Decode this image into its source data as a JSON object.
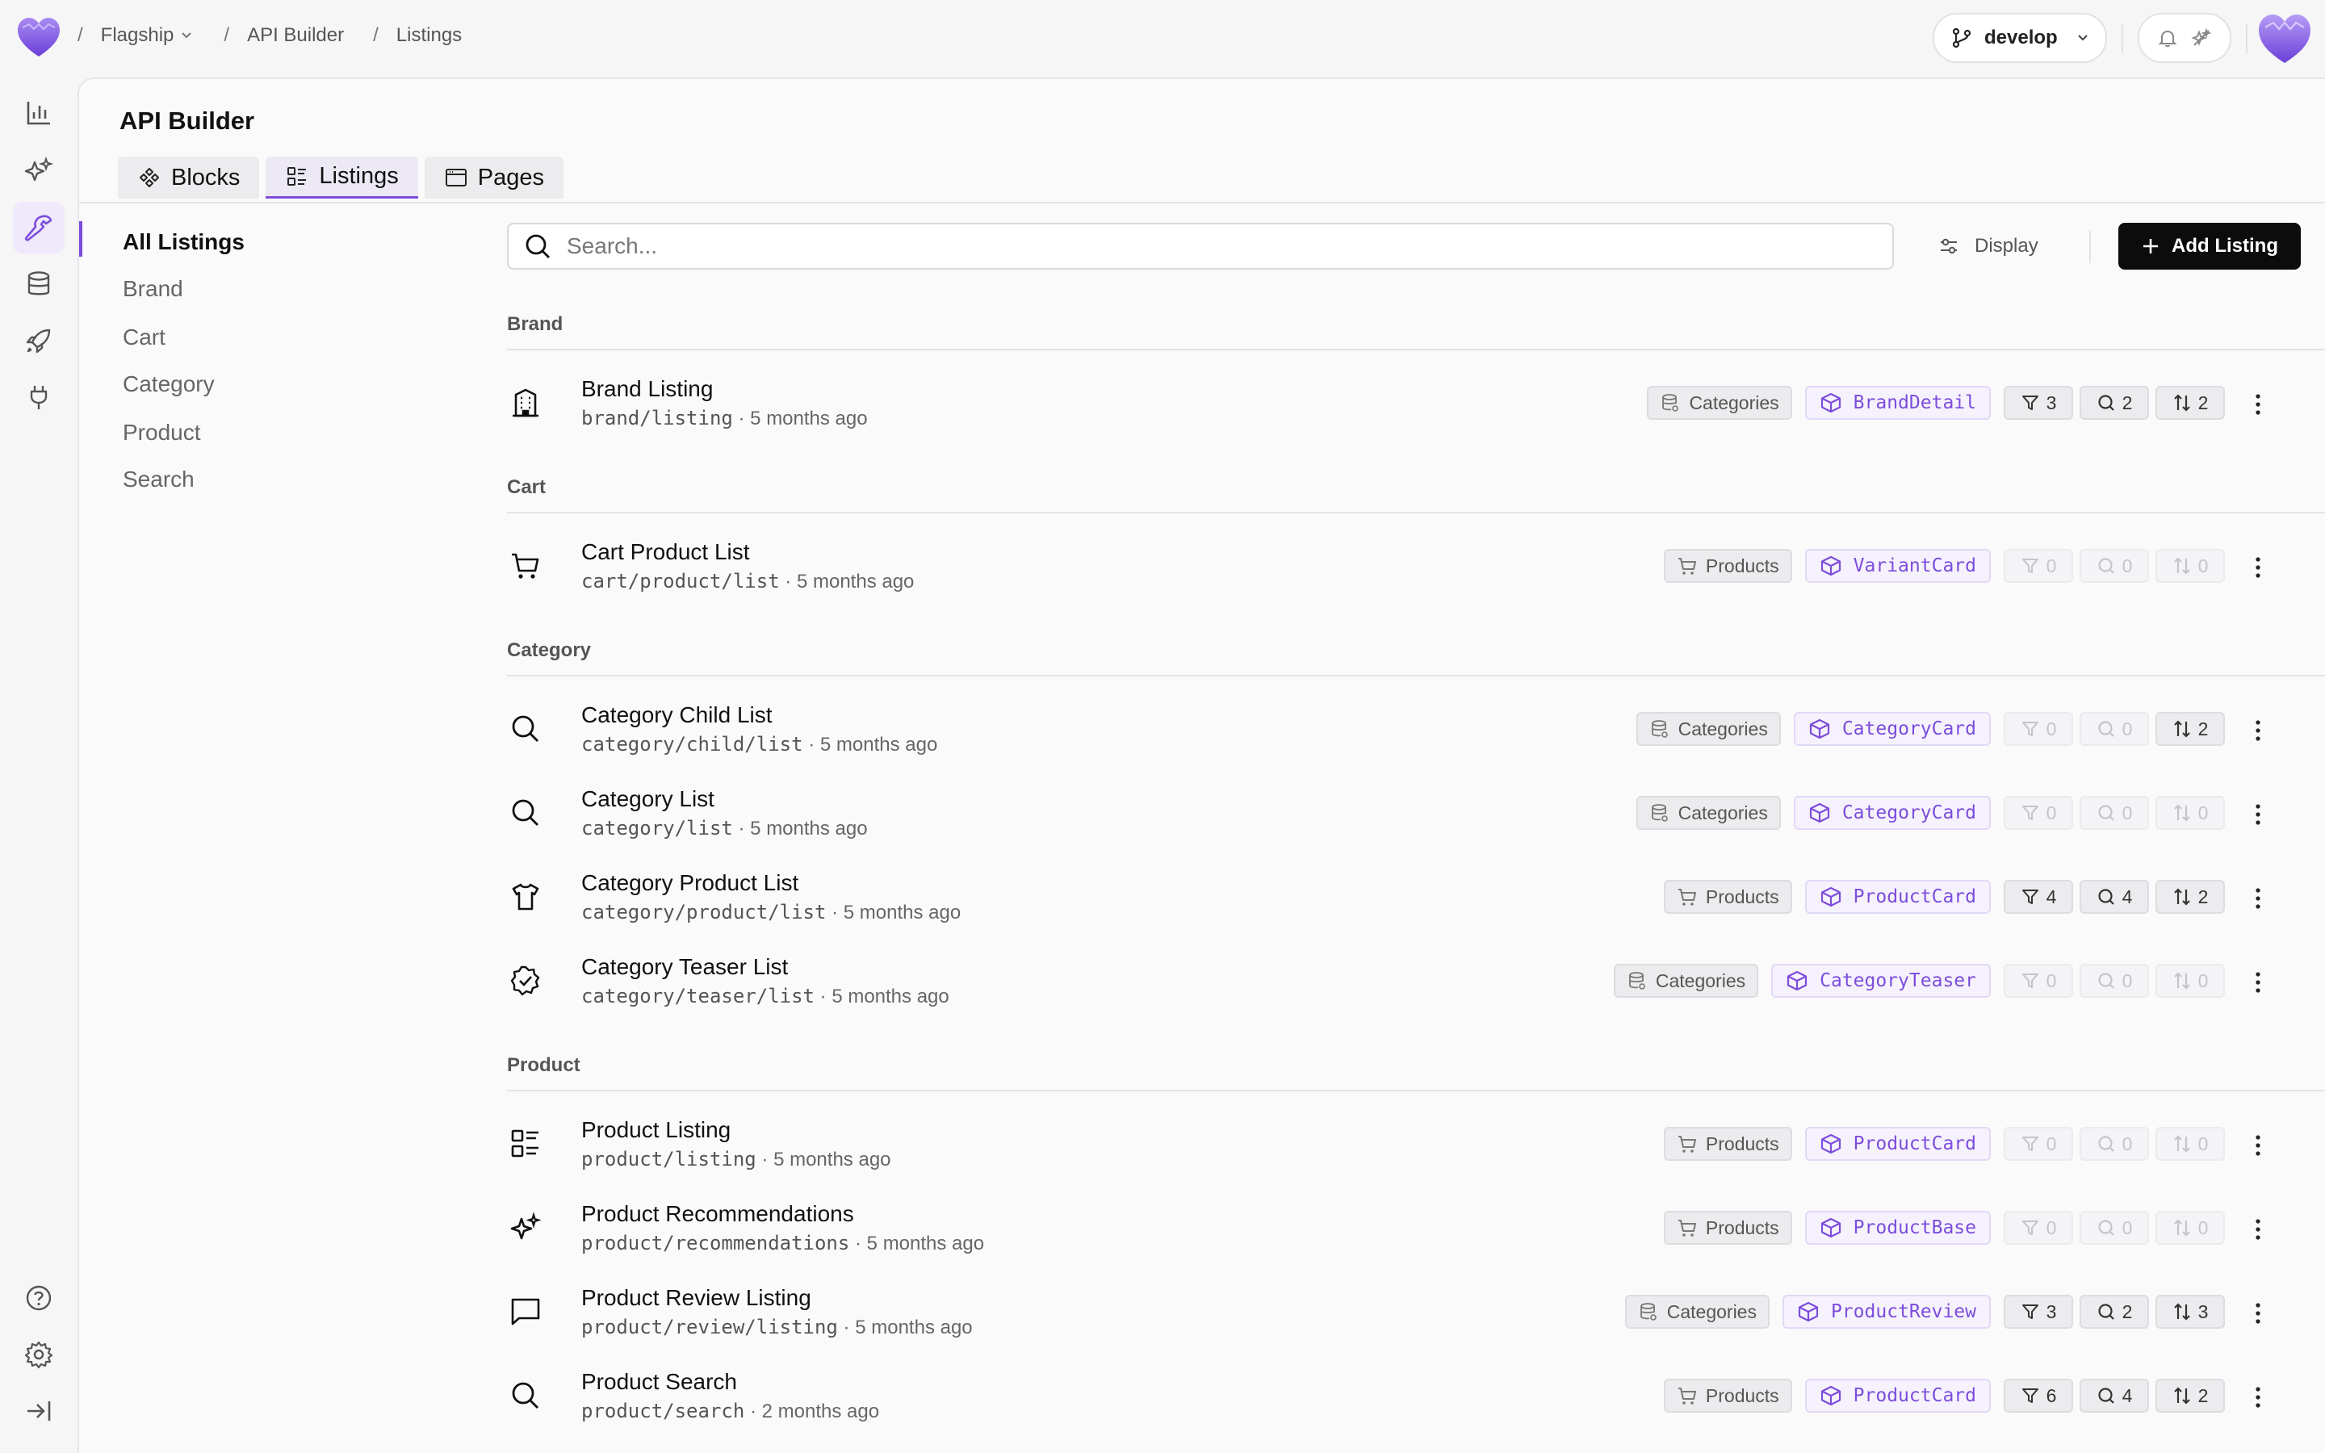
{
  "breadcrumb": {
    "workspace": "Flagship",
    "section": "API Builder",
    "page": "Listings"
  },
  "branch": {
    "label": "develop"
  },
  "title": "API Builder",
  "tabs": [
    {
      "label": "Blocks"
    },
    {
      "label": "Listings",
      "active": true
    },
    {
      "label": "Pages"
    }
  ],
  "sidebar": {
    "items": [
      {
        "label": "All Listings",
        "active": true
      },
      {
        "label": "Brand"
      },
      {
        "label": "Cart"
      },
      {
        "label": "Category"
      },
      {
        "label": "Product"
      },
      {
        "label": "Search"
      }
    ]
  },
  "search": {
    "placeholder": "Search..."
  },
  "toolbar": {
    "display_label": "Display",
    "add_label": "Add Listing"
  },
  "colors": {
    "accent": "#7c4ddb",
    "primary_button": "#0c0c0c"
  },
  "groups": [
    {
      "label": "Brand",
      "rows": [
        {
          "icon": "building-icon",
          "name": "Brand Listing",
          "path": "brand/listing",
          "age": " · 5 months ago",
          "source": "Categories",
          "card": "BrandDetail",
          "filters": "3",
          "search": "2",
          "sort": "2"
        }
      ]
    },
    {
      "label": "Cart",
      "rows": [
        {
          "icon": "cart-icon",
          "name": "Cart Product List",
          "path": "cart/product/list",
          "age": " · 5 months ago",
          "source": "Products",
          "card": "VariantCard",
          "filters": "0",
          "search": "0",
          "sort": "0"
        }
      ]
    },
    {
      "label": "Category",
      "rows": [
        {
          "icon": "search-icon",
          "name": "Category Child List",
          "path": "category/child/list",
          "age": " · 5 months ago",
          "source": "Categories",
          "card": "CategoryCard",
          "filters": "0",
          "search": "0",
          "sort": "2"
        },
        {
          "icon": "search-icon",
          "name": "Category List",
          "path": "category/list",
          "age": " · 5 months ago",
          "source": "Categories",
          "card": "CategoryCard",
          "filters": "0",
          "search": "0",
          "sort": "0"
        },
        {
          "icon": "shirt-icon",
          "name": "Category Product List",
          "path": "category/product/list",
          "age": " · 5 months ago",
          "source": "Products",
          "card": "ProductCard",
          "filters": "4",
          "search": "4",
          "sort": "2"
        },
        {
          "icon": "badge-check-icon",
          "name": "Category Teaser List",
          "path": "category/teaser/list",
          "age": " · 5 months ago",
          "source": "Categories",
          "card": "CategoryTeaser",
          "filters": "0",
          "search": "0",
          "sort": "0"
        }
      ]
    },
    {
      "label": "Product",
      "rows": [
        {
          "icon": "list-grid-icon",
          "name": "Product Listing",
          "path": "product/listing",
          "age": " · 5 months ago",
          "source": "Products",
          "card": "ProductCard",
          "filters": "0",
          "search": "0",
          "sort": "0"
        },
        {
          "icon": "sparkles-icon",
          "name": "Product Recommendations",
          "path": "product/recommendations",
          "age": " · 5 months ago",
          "source": "Products",
          "card": "ProductBase",
          "filters": "0",
          "search": "0",
          "sort": "0"
        },
        {
          "icon": "message-icon",
          "name": "Product Review Listing",
          "path": "product/review/listing",
          "age": " · 5 months ago",
          "source": "Categories",
          "card": "ProductReview",
          "filters": "3",
          "search": "2",
          "sort": "3"
        },
        {
          "icon": "search-icon",
          "name": "Product Search",
          "path": "product/search",
          "age": " · 2 months ago",
          "source": "Products",
          "card": "ProductCard",
          "filters": "6",
          "search": "4",
          "sort": "2"
        }
      ]
    }
  ]
}
